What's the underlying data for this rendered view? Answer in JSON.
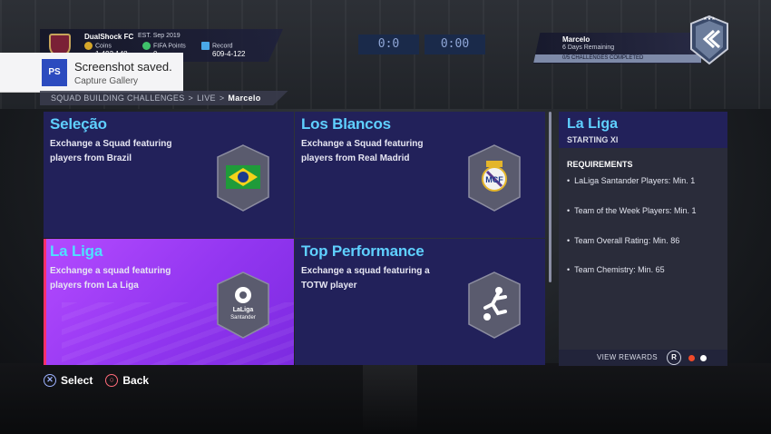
{
  "header": {
    "club_name": "DualShock FC",
    "club_est": "EST. Sep 2019",
    "stats": [
      {
        "label": "Coins",
        "value": "1,493,148",
        "icon": "coins-icon"
      },
      {
        "label": "FIFA Points",
        "value": "0",
        "icon": "fifa-points-icon"
      },
      {
        "label": "Record",
        "value": "609-4-122",
        "icon": "record-icon"
      }
    ],
    "scoreboard": [
      "0:0",
      "0:00"
    ]
  },
  "player_challenge": {
    "name": "Marcelo",
    "time_remaining": "6 Days Remaining",
    "progress_text": "0/5 CHALLENGES COMPLETED",
    "progress": 0
  },
  "toast": {
    "title": "Screenshot saved.",
    "subtitle": "Capture Gallery",
    "icon": "playstation-icon"
  },
  "breadcrumb": {
    "items": [
      "SQUAD BUILDING CHALLENGES",
      "LIVE",
      "Marcelo"
    ]
  },
  "tiles": [
    {
      "title": "Seleção",
      "desc": "Exchange a Squad featuring players from Brazil",
      "icon": "brazil-flag-icon"
    },
    {
      "title": "Los Blancos",
      "desc": "Exchange a Squad featuring players from Real Madrid",
      "icon": "real-madrid-crest-icon"
    },
    {
      "title": "La Liga",
      "desc": "Exchange a squad featuring players from La Liga",
      "icon": "laliga-logo-icon",
      "logo_text": "LaLiga Santander"
    },
    {
      "title": "Top Performance",
      "desc": "Exchange a squad featuring a TOTW player",
      "icon": "footballer-icon"
    }
  ],
  "panel": {
    "title": "La Liga",
    "subtitle": "STARTING XI",
    "requirements_heading": "REQUIREMENTS",
    "requirements": [
      "LaLiga Santander Players: Min. 1",
      "Team of the Week Players: Min. 1",
      "Team Overall Rating: Min. 86",
      "Team Chemistry: Min. 65"
    ],
    "view_rewards": "VIEW REWARDS",
    "r_button": "R"
  },
  "controls": {
    "select": "Select",
    "back": "Back"
  },
  "colors": {
    "tile_bg": "#22215a",
    "selected_tile": "#9236f0",
    "title_accent": "#5fd0ff"
  }
}
